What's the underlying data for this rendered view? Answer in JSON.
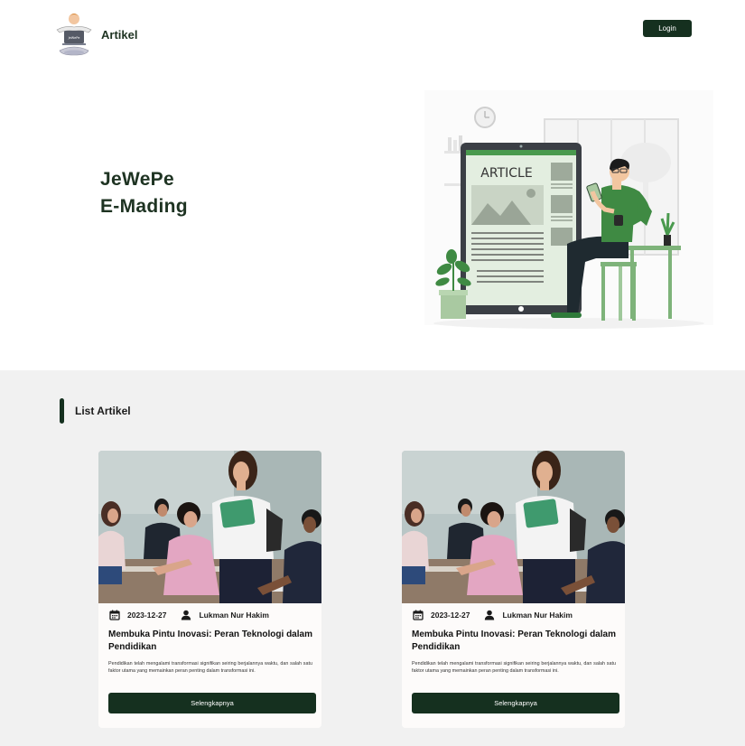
{
  "nav": {
    "brand_name": "Artikel",
    "logo_text": "JeWePe",
    "login_label": "Login"
  },
  "hero": {
    "title_line1": "JeWePe",
    "title_line2": "E-Mading",
    "illustration_label": "ARTICLE"
  },
  "section": {
    "title": "List Artikel"
  },
  "articles": [
    {
      "date": "2023-12-27",
      "author": "Lukman Nur Hakim",
      "title": "Membuka Pintu Inovasi: Peran Teknologi dalam Pendidikan",
      "description": "Pendidikan telah mengalami transformasi signifikan seiring berjalannya waktu, dan salah satu faktor utama yang memainkan peran penting dalam transformasi ini.",
      "button_label": "Selengkapnya"
    },
    {
      "date": "2023-12-27",
      "author": "Lukman Nur Hakim",
      "title": "Membuka Pintu Inovasi: Peran Teknologi dalam Pendidikan",
      "description": "Pendidikan telah mengalami transformasi signifikan seiring berjalannya waktu, dan salah satu faktor utama yang memainkan peran penting dalam transformasi ini.",
      "button_label": "Selengkapnya"
    }
  ],
  "icons": {
    "calendar": "calendar-icon",
    "author": "user-icon"
  },
  "colors": {
    "primary": "#15301f",
    "accent_green": "#4a9a4e",
    "section_bg": "#f1f1f1"
  }
}
